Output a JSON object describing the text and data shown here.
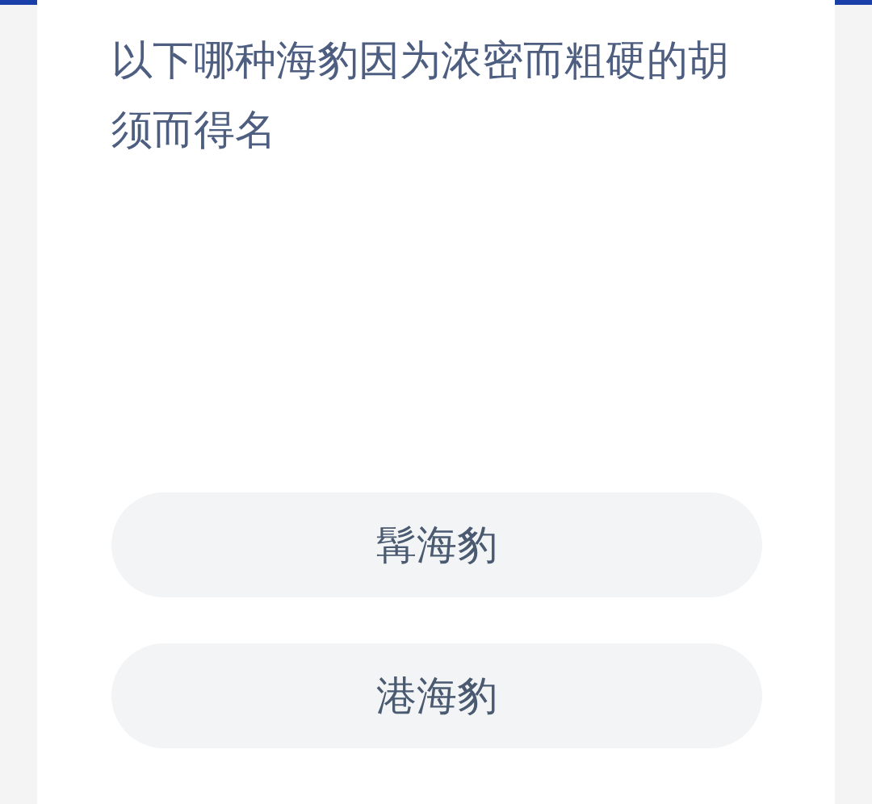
{
  "question": "以下哪种海豹因为浓密而粗硬的胡须而得名",
  "options": [
    {
      "label": "髯海豹"
    },
    {
      "label": "港海豹"
    }
  ]
}
